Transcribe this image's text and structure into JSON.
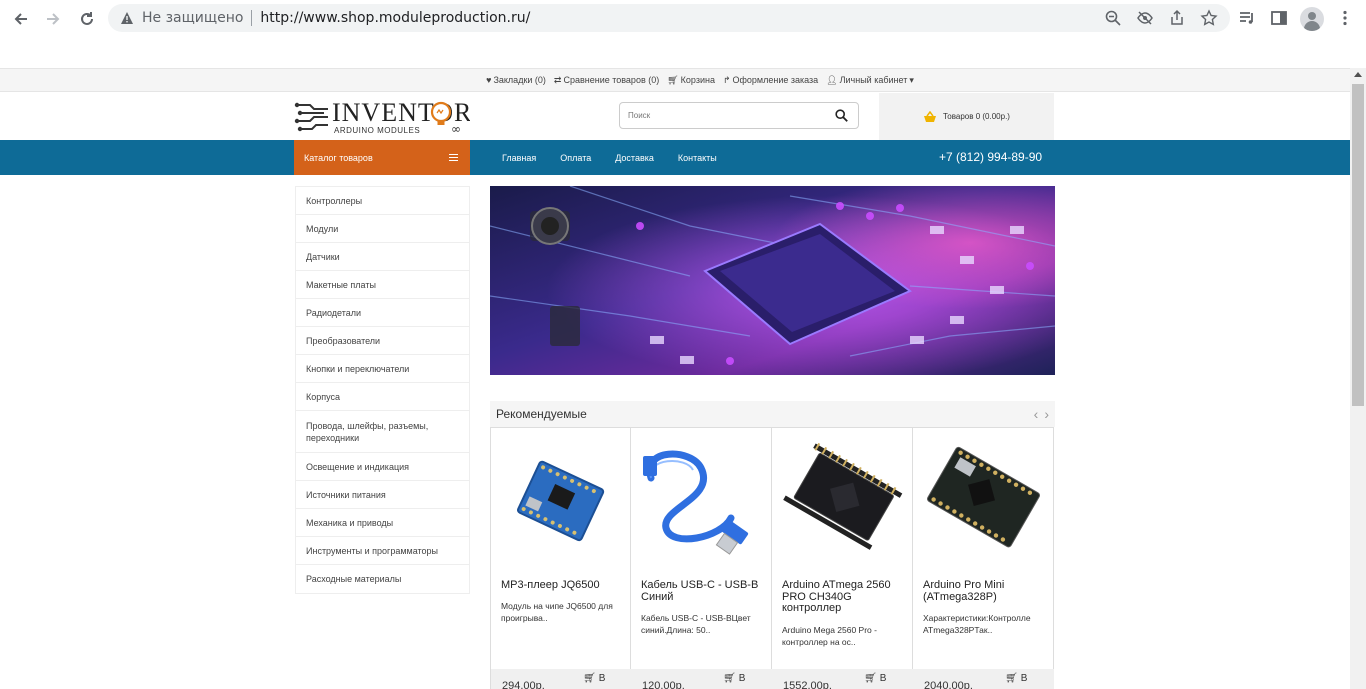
{
  "browser": {
    "security_status": "Не защищено",
    "url": "http://www.shop.moduleproduction.ru/"
  },
  "topbar": {
    "bookmarks": "Закладки (0)",
    "compare": "Сравнение товаров (0)",
    "cart": "Корзина",
    "checkout": "Оформление заказа",
    "account": "Личный кабинет"
  },
  "header": {
    "logo_title": "INVENTOR",
    "logo_sub": "ARDUINO MODULES",
    "search_placeholder": "Поиск",
    "cart_summary": "Товаров 0 (0.00р.)"
  },
  "navbar": {
    "catalog": "Каталог товаров",
    "menu": [
      "Главная",
      "Оплата",
      "Доставка",
      "Контакты"
    ],
    "phone": "+7 (812) 994-89-90"
  },
  "categories": [
    "Контроллеры",
    "Модули",
    "Датчики",
    "Макетные платы",
    "Радиодетали",
    "Преобразователи",
    "Кнопки и переключатели",
    "Корпуса",
    "Провода, шлейфы, разъемы, переходники",
    "Освещение и индикация",
    "Источники питания",
    "Механика и приводы",
    "Инструменты и программаторы",
    "Расходные материалы"
  ],
  "featured": {
    "title": "Рекомендуемые",
    "products": [
      {
        "name": "MP3-плеер JQ6500",
        "desc": "Модуль на чипе JQ6500 для проигрыва..",
        "price": "294.00р.",
        "buy": "В"
      },
      {
        "name": "Кабель USB-C - USB-B Синий",
        "desc": "Кабель USB-C - USB-BЦвет синий.Длина: 50..",
        "price": "120.00р.",
        "buy": "В"
      },
      {
        "name": "Arduino ATmega 2560 PRO CH340G контроллер",
        "desc": "Arduino Mega 2560 Pro - контроллер на ос..",
        "price": "1552.00р.",
        "buy": "В"
      },
      {
        "name": "Arduino Pro Mini (ATmega328P)",
        "desc": "Характеристики:Контролле ATmega328PТак..",
        "price": "2040.00р.",
        "buy": "В"
      }
    ]
  }
}
